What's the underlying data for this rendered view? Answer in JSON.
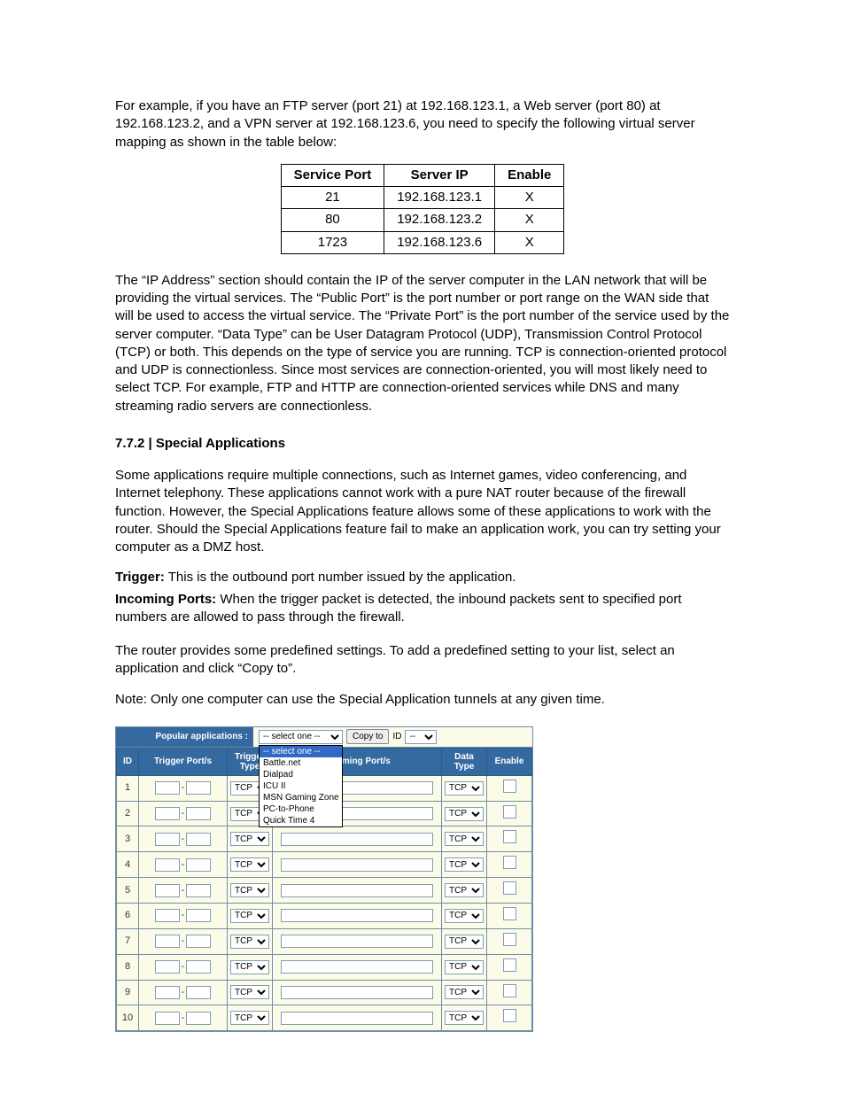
{
  "para1": "For example, if you have an FTP server (port 21) at 192.168.123.1, a Web server (port 80) at 192.168.123.2, and a VPN server at 192.168.123.6, you need to specify the following virtual server mapping as shown in the table below:",
  "doc_table": {
    "headers": [
      "Service Port",
      "Server IP",
      "Enable"
    ],
    "rows": [
      [
        "21",
        "192.168.123.1",
        "X"
      ],
      [
        "80",
        "192.168.123.2",
        "X"
      ],
      [
        "1723",
        "192.168.123.6",
        "X"
      ]
    ]
  },
  "para2": "The “IP Address” section should contain the IP of the server computer in the LAN network that will be providing the virtual services. The “Public Port” is the port number or port range on the WAN side that will be used to access the virtual service. The “Private Port” is the port number of the service used by the server computer. “Data Type” can be User Datagram Protocol (UDP), Transmission Control Protocol (TCP) or both. This depends on the type of service you are running. TCP is connection-oriented protocol and UDP is connectionless. Since most services are connection-oriented, you will most likely need to select TCP. For example, FTP and HTTP are connection-oriented services while DNS and many streaming radio servers are connectionless.",
  "section_heading": "7.7.2 | Special Applications",
  "para3": "Some applications require multiple connections, such as Internet games, video conferencing, and Internet telephony. These applications cannot work with a pure NAT router because of the firewall function. However, the Special Applications feature allows some of these applications to work with the router. Should the Special Applications feature fail to make an application work, you can try setting your computer as a DMZ host.",
  "def_trigger_label": "Trigger:",
  "def_trigger_text": " This is the outbound port number issued by the application.",
  "def_incoming_label": "Incoming Ports:",
  "def_incoming_text": " When the trigger packet is detected, the inbound packets sent to specified port numbers are allowed to pass through the firewall.",
  "para4": "The router provides some predefined settings. To add a predefined setting to your list, select an application and click “Copy to”.",
  "para5": "Note: Only one computer can use the Special Application tunnels at any given time.",
  "router": {
    "popular_label": "Popular applications :",
    "app_select_value": "-- select one --",
    "app_select_options": [
      "-- select one --",
      "Battle.net",
      "Dialpad",
      "ICU II",
      "MSN Gaming Zone",
      "PC-to-Phone",
      "Quick Time 4"
    ],
    "copy_to_label": "Copy to",
    "id_label": "ID",
    "id_select_value": "--",
    "headers": [
      "ID",
      "Trigger Port/s",
      "Trigger Type",
      "Incoming Port/s",
      "Data Type",
      "Enable"
    ],
    "row_ids": [
      "1",
      "2",
      "3",
      "4",
      "5",
      "6",
      "7",
      "8",
      "9",
      "10"
    ],
    "tcp_option": "TCP"
  }
}
